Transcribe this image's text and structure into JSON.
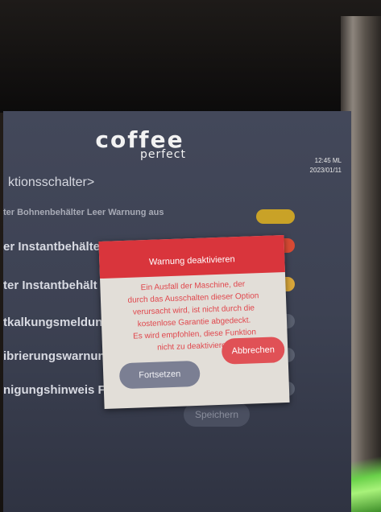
{
  "header": {
    "logo_top": "coffee",
    "logo_bottom": "perfect",
    "time": "12:45 ML",
    "date": "2023/01/11"
  },
  "breadcrumb": "ktionsschalter>",
  "rows": [
    {
      "label": "ter Bohnenbehälter Leer Warnung aus",
      "toggle_color": "#c9a227"
    },
    {
      "label": "er Instantbehälter Leer Warnung aus",
      "toggle_color": "#d84a34"
    },
    {
      "label": "ter Instantbehält",
      "toggle_color": "#d8a63a"
    },
    {
      "label": "tkalkungsmeldung",
      "toggle_color": "#5a6070"
    },
    {
      "label": "ibrierungswarnung",
      "toggle_color": "#5a6070"
    },
    {
      "label": "nigungshinweis F",
      "toggle_color": "#5a6070"
    }
  ],
  "save_label": "Speichern",
  "dialog": {
    "title": "Warnung deaktivieren",
    "body_lines": [
      "Ein Ausfall der Maschine, der",
      "durch das Ausschalten dieser Option",
      "verursacht wird, ist nicht durch die",
      "kostenlose Garantie abgedeckt.",
      "Es wird empfohlen, diese Funktion",
      "nicht zu deaktivieren."
    ],
    "continue_label": "Fortsetzen",
    "cancel_label": "Abbrechen"
  },
  "colors": {
    "dialog_header": "#d9353c",
    "cancel_button": "#e05156",
    "continue_button": "#7b7f93",
    "screen_bg": "#43485a"
  }
}
